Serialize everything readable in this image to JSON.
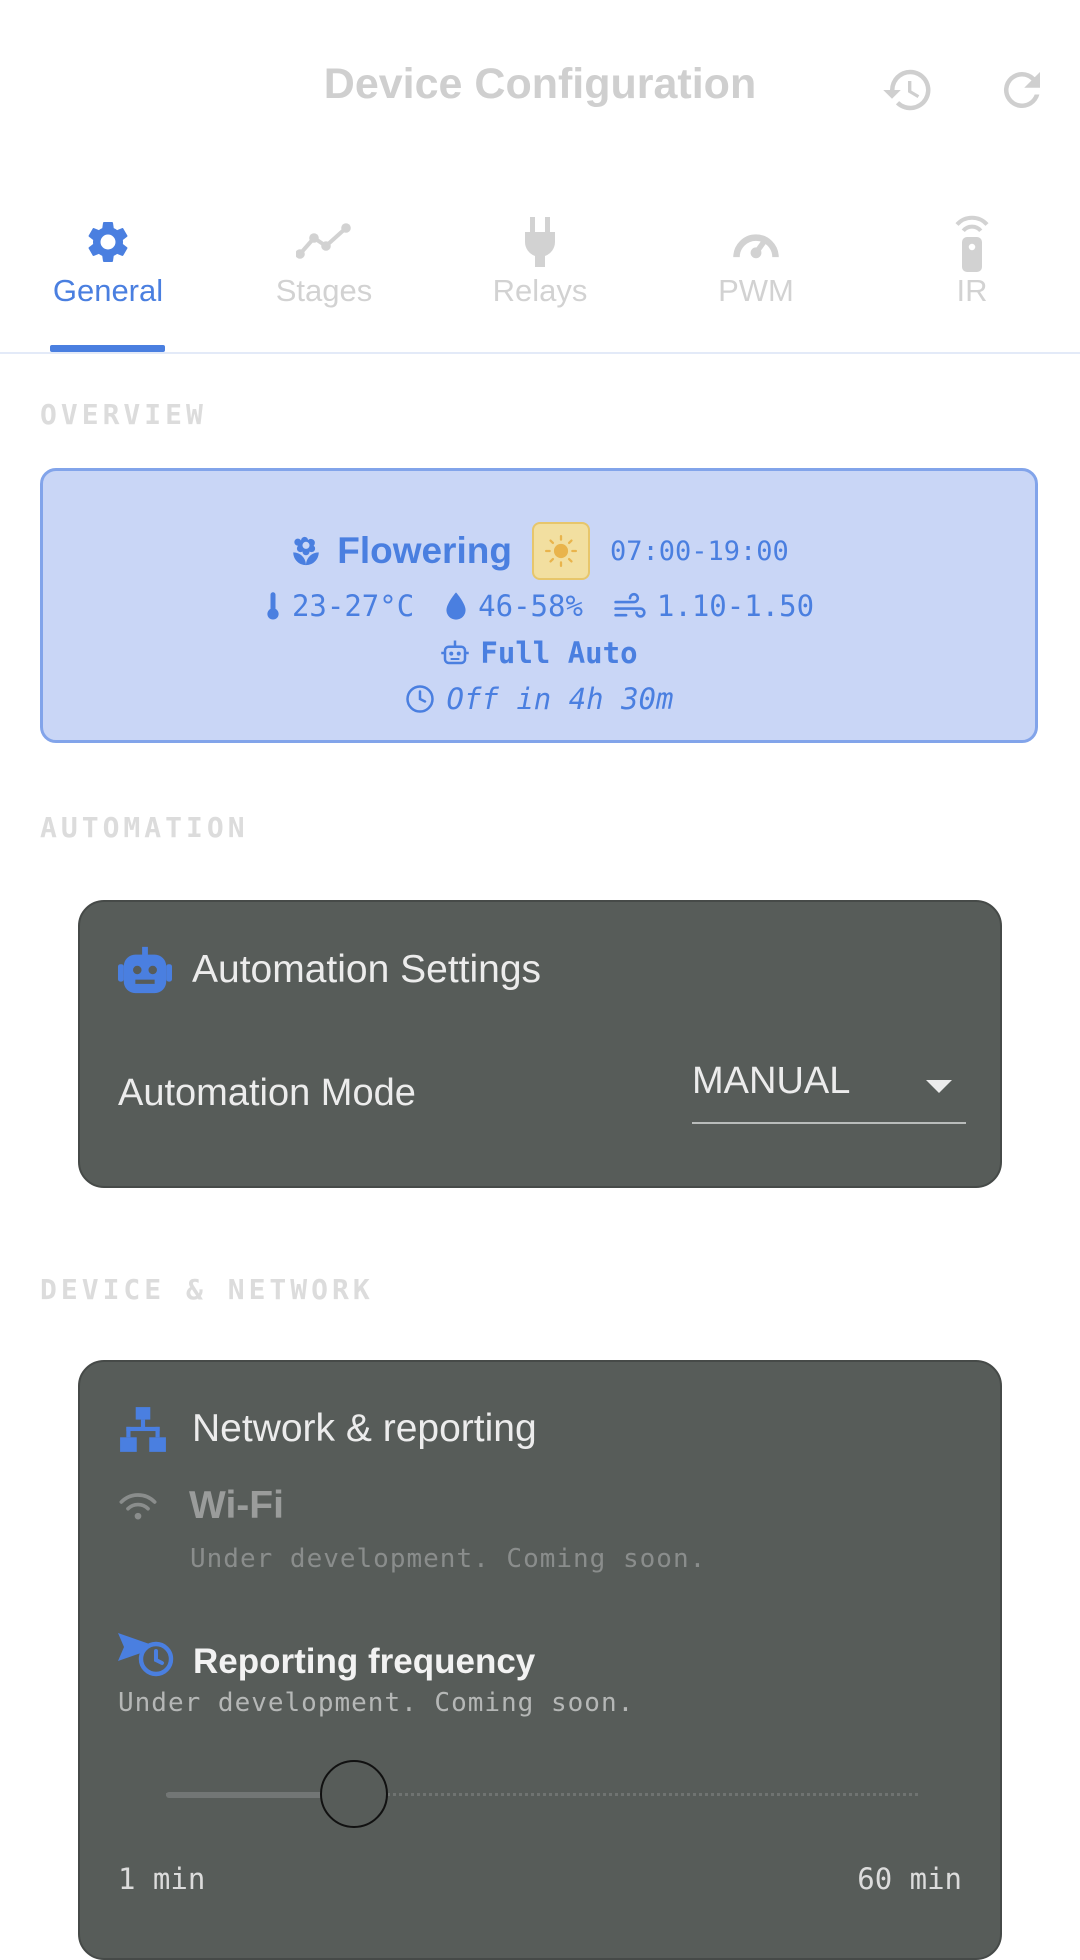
{
  "header": {
    "title": "Device Configuration",
    "history_icon": "history-icon",
    "refresh_icon": "refresh-icon"
  },
  "tabs": [
    {
      "label": "General",
      "icon": "gear-icon",
      "active": true
    },
    {
      "label": "Stages",
      "icon": "chart-line-icon",
      "active": false
    },
    {
      "label": "Relays",
      "icon": "plug-icon",
      "active": false
    },
    {
      "label": "PWM",
      "icon": "gauge-icon",
      "active": false
    },
    {
      "label": "IR",
      "icon": "remote-icon",
      "active": false
    }
  ],
  "sections": {
    "overview": "OVERVIEW",
    "automation": "AUTOMATION",
    "device_network": "DEVICE & NETWORK"
  },
  "overview": {
    "stage": "Flowering",
    "light_schedule": "07:00-19:00",
    "temperature": "23-27°C",
    "humidity": "46-58%",
    "vpd": "1.10-1.50",
    "mode": "Full Auto",
    "countdown": "Off in 4h 30m"
  },
  "automation": {
    "title": "Automation Settings",
    "mode_label": "Automation Mode",
    "mode_value": "MANUAL"
  },
  "network": {
    "title": "Network & reporting",
    "wifi_title": "Wi-Fi",
    "wifi_subtitle": "Under development. Coming soon.",
    "reporting_title": "Reporting frequency",
    "reporting_subtitle": "Under development. Coming soon.",
    "slider_value_fraction": 0.25,
    "slider_min_label": "1 min",
    "slider_max_label": "60 min"
  },
  "colors": {
    "accent": "#4a7fe0",
    "card_dark": "#575c59",
    "overview_bg": "#c9d6f6",
    "sun": "#e9b44c"
  }
}
